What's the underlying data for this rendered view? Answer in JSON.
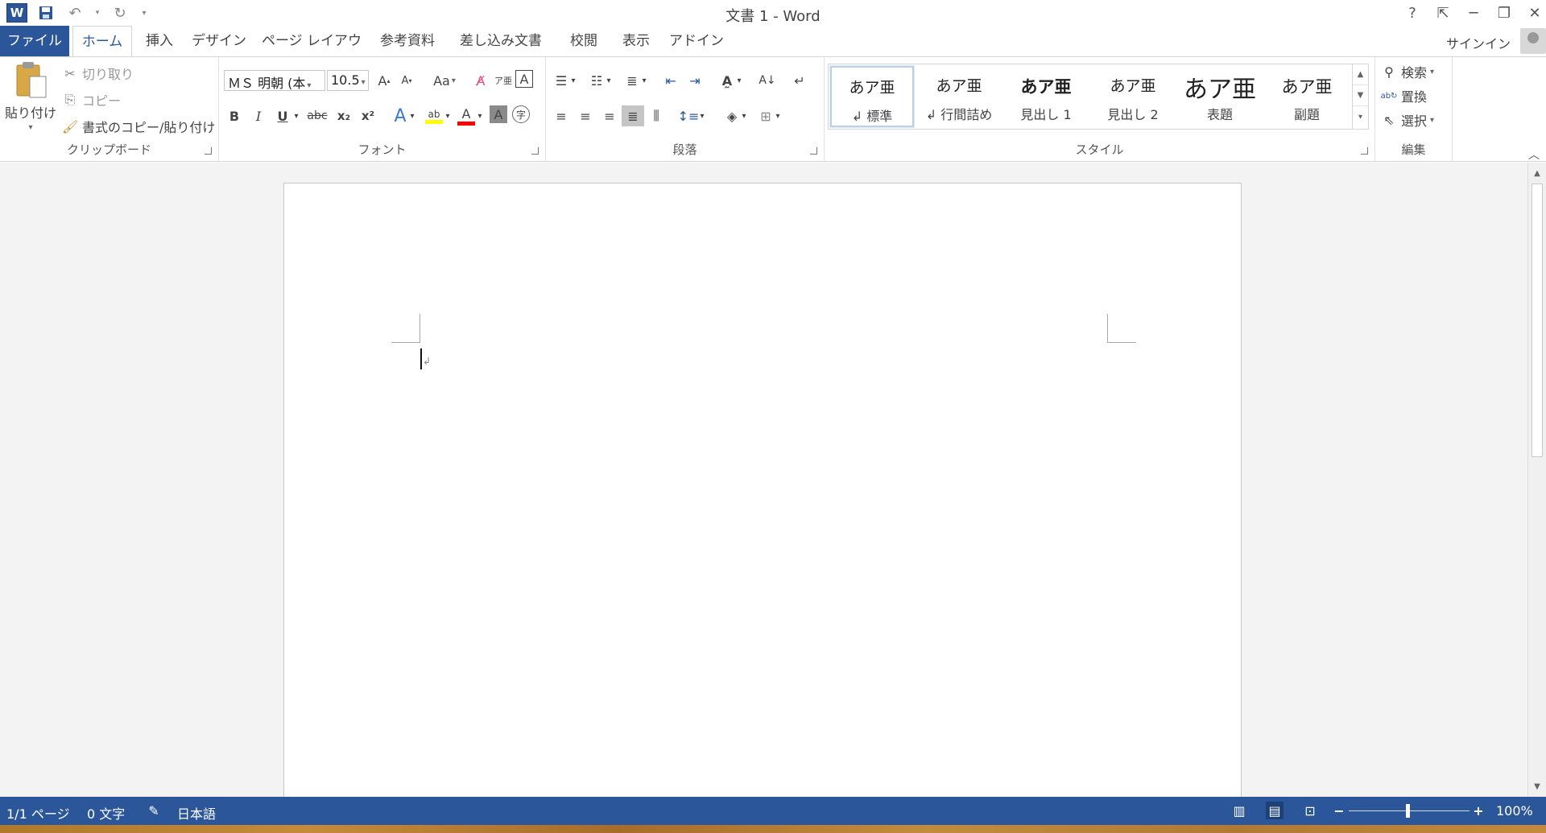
{
  "title": "文書 1 - Word",
  "quick_access": {
    "app_icon": "W",
    "save_icon": "save-icon",
    "undo_icon": "undo-icon",
    "redo_icon": "redo-icon",
    "customize_icon": "customize-qat-icon"
  },
  "window_controls": {
    "help": "?",
    "ribbon_options": "⇱",
    "minimize": "─",
    "restore": "❐",
    "close": "✕"
  },
  "tabs": [
    {
      "label": "ファイル"
    },
    {
      "label": "ホーム"
    },
    {
      "label": "挿入"
    },
    {
      "label": "デザイン"
    },
    {
      "label": "ページ レイアウト"
    },
    {
      "label": "参考資料"
    },
    {
      "label": "差し込み文書"
    },
    {
      "label": "校閲"
    },
    {
      "label": "表示"
    },
    {
      "label": "アドイン"
    }
  ],
  "signin": "サインイン",
  "clipboard": {
    "label": "クリップボード",
    "paste": "貼り付け",
    "cut": "切り取り",
    "copy": "コピー",
    "format_painter": "書式のコピー/貼り付け"
  },
  "font": {
    "label": "フォント",
    "font_name": "ＭＳ 明朝 (本",
    "font_size": "10.5",
    "change_case": "Aa",
    "bold": "B",
    "italic": "I",
    "underline": "U",
    "strikethrough": "abc",
    "subscript": "x₂",
    "superscript": "x²"
  },
  "paragraph": {
    "label": "段落"
  },
  "styles": {
    "label": "スタイル",
    "items": [
      {
        "sample": "あア亜",
        "name": "↲ 標準"
      },
      {
        "sample": "あア亜",
        "name": "↲ 行間詰め"
      },
      {
        "sample": "あア亜",
        "name": "見出し 1"
      },
      {
        "sample": "あア亜",
        "name": "見出し 2"
      },
      {
        "sample": "あア亜",
        "name": "表題"
      },
      {
        "sample": "あア亜",
        "name": "副題"
      }
    ]
  },
  "editing": {
    "label": "編集",
    "find": "検索",
    "replace": "置換",
    "select": "選択"
  },
  "status": {
    "page": "1/1 ページ",
    "words": "0 文字",
    "language": "日本語",
    "zoom": "100%",
    "zoom_level": 1.0
  },
  "colors": {
    "accent": "#2b579a",
    "highlight": "#ffff00",
    "font_color": "#ff0000"
  }
}
